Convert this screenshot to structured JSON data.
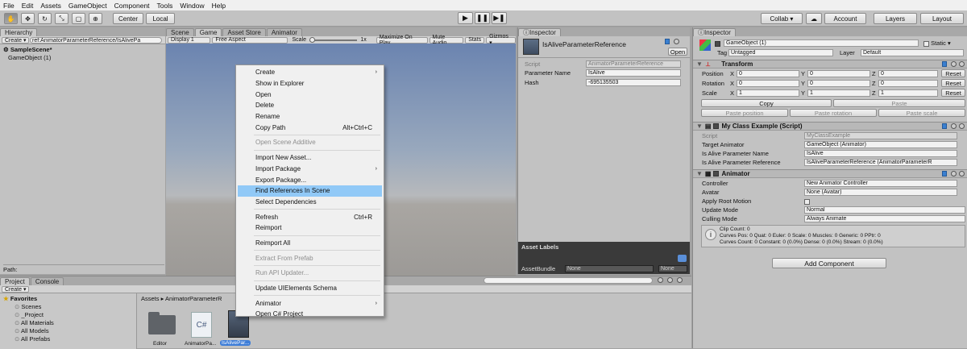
{
  "menubar": [
    "File",
    "Edit",
    "Assets",
    "GameObject",
    "Component",
    "Tools",
    "Window",
    "Help"
  ],
  "toolbar": {
    "center_label": "Center",
    "local_label": "Local",
    "collab_label": "Collab ▾",
    "account_label": "Account",
    "layers_label": "Layers",
    "layout_label": "Layout"
  },
  "hierarchy": {
    "tab": "Hierarchy",
    "create_label": "Create ▾",
    "search_value": "ref:AnimatorParameterReference/IsAlivePa",
    "scene_name": "SampleScene*",
    "items": [
      "GameObject (1)"
    ],
    "path_label": "Path:"
  },
  "center_tabs": {
    "scene": "Scene",
    "game": "Game",
    "asset_store": "Asset Store",
    "animator": "Animator"
  },
  "game_bar": {
    "display": "Display 1",
    "aspect": "Free Aspect",
    "scale_label": "Scale",
    "scale_value": "1x",
    "maximize": "Maximize On Play",
    "mute": "Mute Audio",
    "stats": "Stats",
    "gizmos": "Gizmos ▾"
  },
  "context_menu": [
    {
      "label": "Create",
      "submenu": true
    },
    {
      "label": "Show in Explorer"
    },
    {
      "label": "Open"
    },
    {
      "label": "Delete"
    },
    {
      "label": "Rename"
    },
    {
      "label": "Copy Path",
      "shortcut": "Alt+Ctrl+C"
    },
    {
      "sep": true
    },
    {
      "label": "Open Scene Additive",
      "disabled": true
    },
    {
      "sep": true
    },
    {
      "label": "Import New Asset..."
    },
    {
      "label": "Import Package",
      "submenu": true
    },
    {
      "label": "Export Package..."
    },
    {
      "label": "Find References In Scene",
      "highlighted": true
    },
    {
      "label": "Select Dependencies"
    },
    {
      "sep": true
    },
    {
      "label": "Refresh",
      "shortcut": "Ctrl+R"
    },
    {
      "label": "Reimport"
    },
    {
      "sep": true
    },
    {
      "label": "Reimport All"
    },
    {
      "sep": true
    },
    {
      "label": "Extract From Prefab",
      "disabled": true
    },
    {
      "sep": true
    },
    {
      "label": "Run API Updater...",
      "disabled": true
    },
    {
      "sep": true
    },
    {
      "label": "Update UIElements Schema"
    },
    {
      "sep": true
    },
    {
      "label": "Animator",
      "submenu": true
    },
    {
      "label": "Open C# Project"
    }
  ],
  "inspector1": {
    "tab": "Inspector",
    "title": "IsAliveParameterReference",
    "open_label": "Open",
    "script_label": "Script",
    "script_value": "AnimatorParameterReference",
    "param_label": "Parameter Name",
    "param_value": "IsAlive",
    "hash_label": "Hash",
    "hash_value": "-695135503",
    "asset_labels": "Asset Labels",
    "asset_bundle_label": "AssetBundle",
    "asset_bundle_value": "None",
    "asset_variant_value": "None"
  },
  "inspector2": {
    "tab": "Inspector",
    "object_name": "GameObject (1)",
    "static_label": "Static",
    "tag_label": "Tag",
    "tag_value": "Untagged",
    "layer_label": "Layer",
    "layer_value": "Default",
    "transform": {
      "title": "Transform",
      "rows": [
        {
          "label": "Position",
          "x": "0",
          "y": "0",
          "z": "0"
        },
        {
          "label": "Rotation",
          "x": "0",
          "y": "0",
          "z": "0"
        },
        {
          "label": "Scale",
          "x": "1",
          "y": "1",
          "z": "1"
        }
      ],
      "reset_label": "Reset",
      "copy_label": "Copy",
      "paste_label": "Paste",
      "paste_position": "Paste position",
      "paste_rotation": "Paste rotation",
      "paste_scale": "Paste scale"
    },
    "myclass": {
      "title": "My Class Example (Script)",
      "script_label": "Script",
      "script_value": "MyClassExample",
      "target_label": "Target Animator",
      "target_value": "GameObject (Animator)",
      "name_label": "Is Alive Parameter Name",
      "name_value": "IsAlive",
      "ref_label": "Is Alive Parameter Reference",
      "ref_value": "IsAliveParameterReference (AnimatorParameterR"
    },
    "animator": {
      "title": "Animator",
      "controller_label": "Controller",
      "controller_value": "New Animator Controller",
      "avatar_label": "Avatar",
      "avatar_value": "None (Avatar)",
      "root_motion_label": "Apply Root Motion",
      "update_label": "Update Mode",
      "update_value": "Normal",
      "culling_label": "Culling Mode",
      "culling_value": "Always Animate",
      "info": [
        "Clip Count: 0",
        "Curves Pos: 0 Quat: 0 Euler: 0 Scale: 0 Muscles: 0 Generic: 0 PPtr: 0",
        "Curves Count: 0 Constant: 0 (0.0%) Dense: 0 (0.0%) Stream: 0 (0.0%)"
      ]
    },
    "add_component": "Add Component"
  },
  "project": {
    "tab": "Project",
    "console_tab": "Console",
    "create_label": "Create ▾",
    "favorites_label": "Favorites",
    "favorites": [
      "Scenes",
      "_Project",
      "All Materials",
      "All Models",
      "All Prefabs"
    ],
    "breadcrumb": "Assets ▸ AnimatorParameterR",
    "assets": [
      {
        "label": "Editor",
        "kind": "folder"
      },
      {
        "label": "AnimatorPa...",
        "kind": "cs"
      },
      {
        "label": "IsAlivePar...",
        "kind": "asset",
        "selected": true
      }
    ],
    "cs_text": "C#"
  }
}
